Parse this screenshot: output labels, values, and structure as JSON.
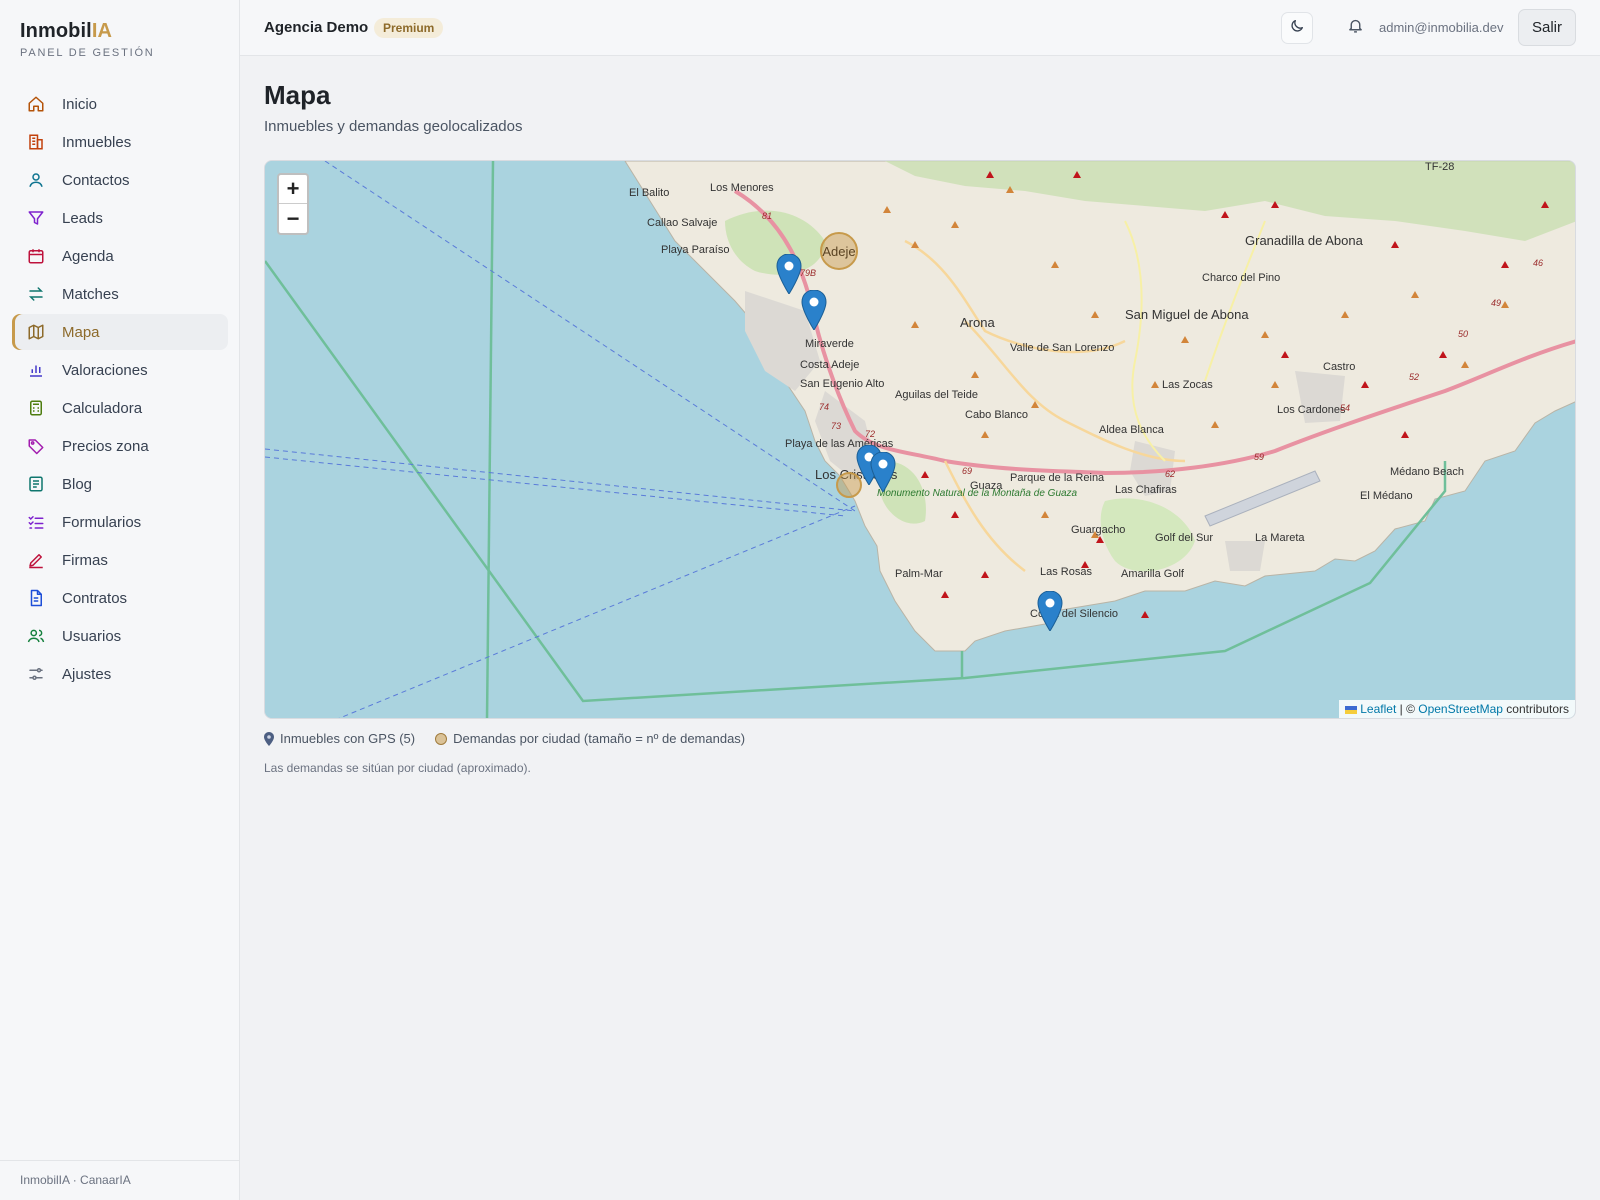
{
  "brand": {
    "name_main": "Inmobil",
    "name_accent": "IA",
    "subtitle": "PANEL DE GESTIÓN"
  },
  "sidebar": {
    "items": [
      {
        "label": "Inicio",
        "icon": "home-icon",
        "color": "#b45309"
      },
      {
        "label": "Inmuebles",
        "icon": "building-icon",
        "color": "#c2410c"
      },
      {
        "label": "Contactos",
        "icon": "user-icon",
        "color": "#0e7490"
      },
      {
        "label": "Leads",
        "icon": "funnel-icon",
        "color": "#7e22ce"
      },
      {
        "label": "Agenda",
        "icon": "calendar-icon",
        "color": "#be123c"
      },
      {
        "label": "Matches",
        "icon": "arrows-icon",
        "color": "#0f766e"
      },
      {
        "label": "Mapa",
        "icon": "map-icon",
        "color": "#8d6a2a",
        "active": true
      },
      {
        "label": "Valoraciones",
        "icon": "bar-chart-icon",
        "color": "#4338ca"
      },
      {
        "label": "Calculadora",
        "icon": "calculator-icon",
        "color": "#4d7c0f"
      },
      {
        "label": "Precios zona",
        "icon": "tag-icon",
        "color": "#a21caf"
      },
      {
        "label": "Blog",
        "icon": "document-icon",
        "color": "#0f766e"
      },
      {
        "label": "Formularios",
        "icon": "checklist-icon",
        "color": "#7e22ce"
      },
      {
        "label": "Firmas",
        "icon": "pen-icon",
        "color": "#be123c"
      },
      {
        "label": "Contratos",
        "icon": "file-icon",
        "color": "#1d4ed8"
      },
      {
        "label": "Usuarios",
        "icon": "users-icon",
        "color": "#15803d"
      },
      {
        "label": "Ajustes",
        "icon": "sliders-icon",
        "color": "#6b7280"
      }
    ],
    "footer": "InmobilIA · CanaarIA"
  },
  "topbar": {
    "agency": "Agencia Demo",
    "plan": "Premium",
    "email": "admin@inmobilia.dev",
    "logout": "Salir"
  },
  "main": {
    "title": "Mapa",
    "subtitle": "Inmuebles y demandas geolocalizados"
  },
  "map": {
    "zoom_in": "+",
    "zoom_out": "−",
    "attribution_leaflet": "Leaflet",
    "attribution_sep": " | © ",
    "attribution_osm": "OpenStreetMap",
    "attribution_tail": " contributors",
    "cluster_label": "Adeje",
    "places": [
      "El Balito",
      "Los Menores",
      "Callao Salvaje",
      "Playa Paraíso",
      "Adeje",
      "Miraverde",
      "Costa Adeje",
      "San Eugenio Alto",
      "Playa de las Américas",
      "Los Cristianos",
      "Arona",
      "Valle de San Lorenzo",
      "Aguilas del Teide",
      "Cabo Blanco",
      "Guaza",
      "Parque de la Reina",
      "Palm-Mar",
      "Las Rosas",
      "Costa del Silencio",
      "Guargacho",
      "Aldea Blanca",
      "Las Chafiras",
      "Golf del Sur",
      "Amarilla Golf",
      "La Mareta",
      "San Miguel de Abona",
      "Granadilla de Abona",
      "Charco del Pino",
      "Las Zocas",
      "Los Cardones",
      "Castro",
      "Médano Beach",
      "El Médano",
      "Monumento Natural de la Montaña de Guaza",
      "TF-28"
    ]
  },
  "legend": {
    "properties": "Inmuebles con GPS (5)",
    "demands": "Demandas por ciudad (tamaño = nº de demandas)",
    "note": "Las demandas se sitúan por ciudad (aproximado)."
  }
}
